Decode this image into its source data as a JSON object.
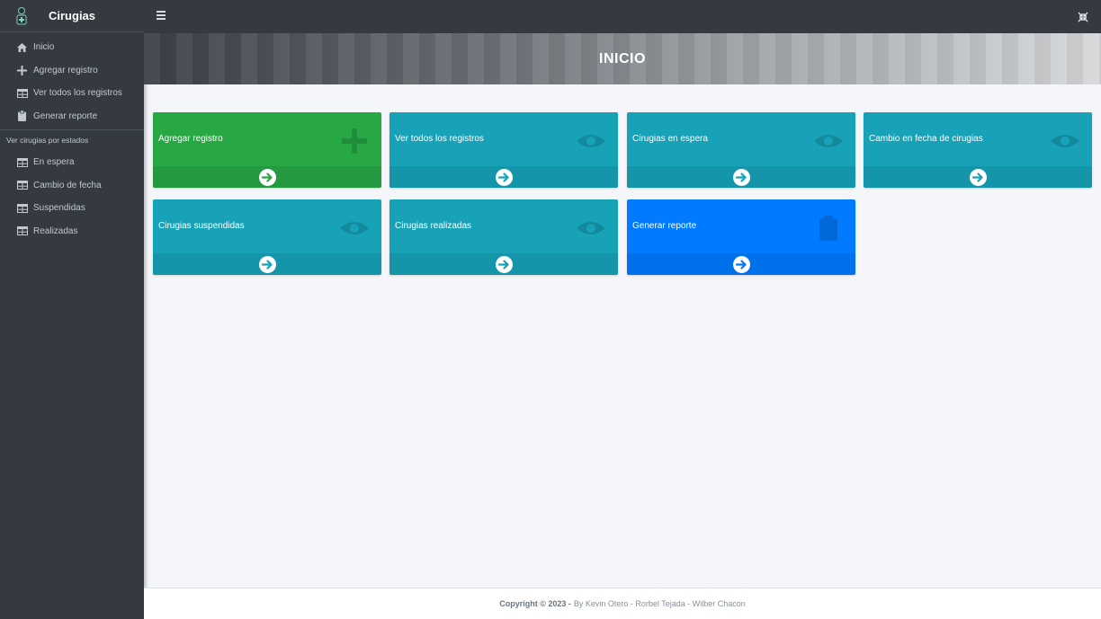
{
  "sidebar": {
    "brand": "Cirugias",
    "items": [
      {
        "label": "Inicio",
        "icon": "home-icon"
      },
      {
        "label": "Agregar registro",
        "icon": "plus-icon"
      },
      {
        "label": "Ver todos los registros",
        "icon": "table-icon"
      },
      {
        "label": "Generar reporte",
        "icon": "clipboard-icon"
      }
    ],
    "section_header": "Ver cirugias por estados",
    "status_items": [
      {
        "label": "En espera",
        "icon": "table-icon"
      },
      {
        "label": "Cambio de fecha",
        "icon": "table-icon"
      },
      {
        "label": "Suspendidas",
        "icon": "table-icon"
      },
      {
        "label": "Realizadas",
        "icon": "table-icon"
      }
    ]
  },
  "hero": {
    "title": "INICIO"
  },
  "cards": [
    {
      "label": "Agregar registro",
      "color": "#28a745",
      "icon": "plus-icon"
    },
    {
      "label": "Ver todos los registros",
      "color": "#17a2b8",
      "icon": "eye-icon"
    },
    {
      "label": "Cirugias en espera",
      "color": "#17a2b8",
      "icon": "eye-icon"
    },
    {
      "label": "Cambio en fecha de cirugias",
      "color": "#17a2b8",
      "icon": "eye-icon"
    },
    {
      "label": "Cirugias suspendidas",
      "color": "#17a2b8",
      "icon": "eye-icon"
    },
    {
      "label": "Cirugias realizadas",
      "color": "#17a2b8",
      "icon": "eye-icon"
    },
    {
      "label": "Generar reporte",
      "color": "#007bff",
      "icon": "clipboard-icon"
    }
  ],
  "footer": {
    "copyright": "Copyright © 2023 -",
    "authors": "By Kevin Otero - Rorbel Tejada - Wilber Chacon"
  }
}
